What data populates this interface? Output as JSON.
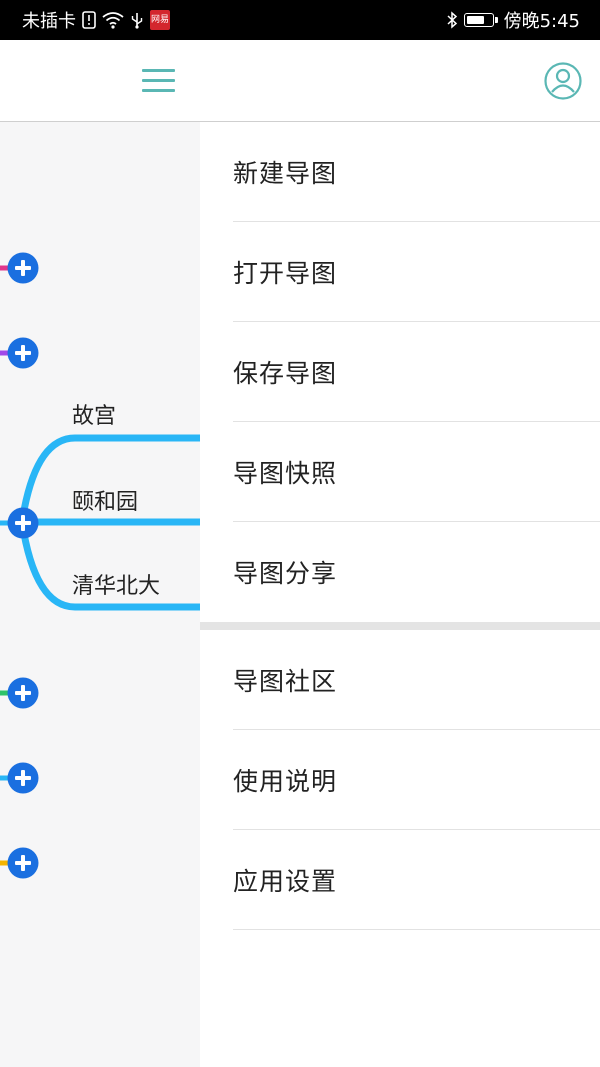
{
  "status_bar": {
    "carrier": "未插卡",
    "netease_badge": "网易",
    "time": "傍晚5:45",
    "battery_level": 0.75
  },
  "header": {
    "menu_icon": "hamburger-menu-icon",
    "account_icon": "user-account-icon",
    "accent_color": "#5ab7b4"
  },
  "mindmap": {
    "branch_color": "#29b6f6",
    "add_button_color": "#1a6fe0",
    "nodes": [
      {
        "label": "故宫"
      },
      {
        "label": "颐和园"
      },
      {
        "label": "清华北大"
      }
    ],
    "stub_colors": [
      "#e0368c",
      "#a048e8",
      "#29b6f6",
      "#2ec36a",
      "#29b6f6",
      "#f4b400"
    ]
  },
  "drawer": {
    "primary_items": [
      {
        "label": "新建导图"
      },
      {
        "label": "打开导图"
      },
      {
        "label": "保存导图"
      },
      {
        "label": "导图快照"
      },
      {
        "label": "导图分享"
      }
    ],
    "secondary_items": [
      {
        "label": "导图社区"
      },
      {
        "label": "使用说明"
      },
      {
        "label": "应用设置"
      }
    ]
  }
}
